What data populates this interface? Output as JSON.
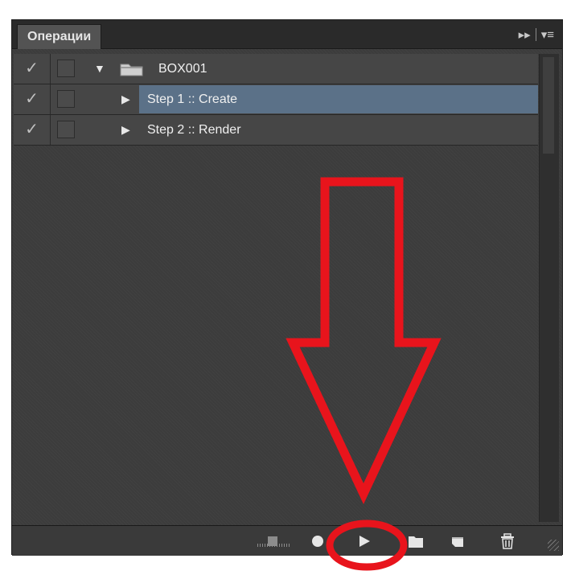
{
  "panel": {
    "tab_label": "Операции",
    "tab_controls": [
      "collapse-icon",
      "panel-menu-icon"
    ]
  },
  "actions": [
    {
      "checked": true,
      "check_glyph": "✓",
      "type": "set",
      "expanded": true,
      "label": "BOX001",
      "selected": false
    },
    {
      "checked": true,
      "check_glyph": "✓",
      "type": "action",
      "expanded": false,
      "label": "Step 1 :: Create",
      "selected": true
    },
    {
      "checked": true,
      "check_glyph": "✓",
      "type": "action",
      "expanded": false,
      "label": "Step 2 :: Render",
      "selected": false
    }
  ],
  "toolbar": {
    "buttons": [
      "stop-icon",
      "record-icon",
      "play-icon",
      "new-set-icon",
      "new-action-icon",
      "trash-icon"
    ]
  },
  "annotation": {
    "color": "#e8141c"
  }
}
